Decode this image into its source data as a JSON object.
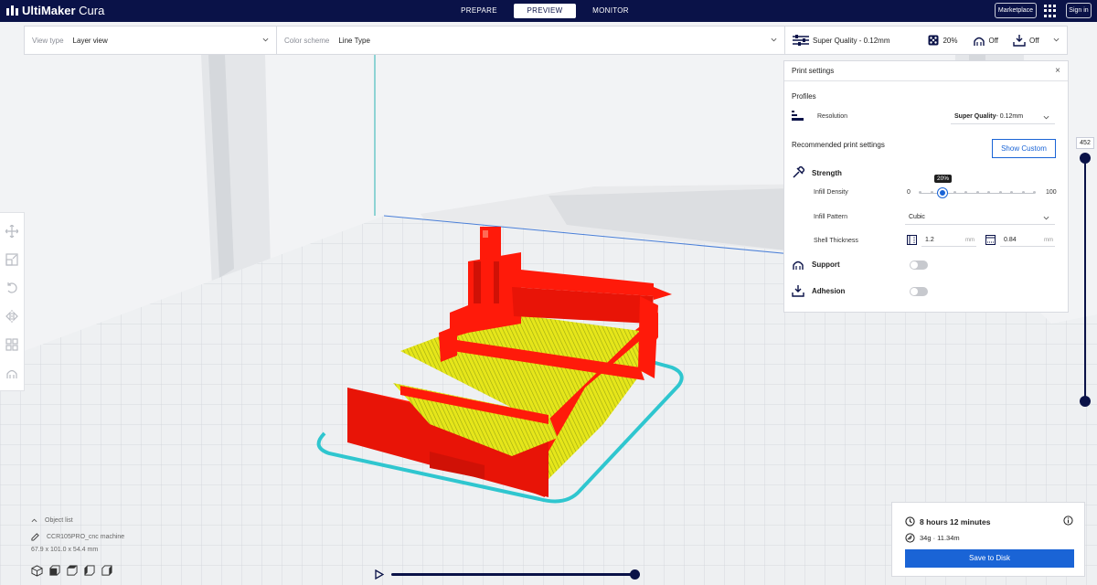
{
  "app": {
    "brand": "UltiMaker",
    "product": "Cura",
    "tabs": [
      {
        "label": "PREPARE",
        "active": false
      },
      {
        "label": "PREVIEW",
        "active": true
      },
      {
        "label": "MONITOR",
        "active": false
      }
    ],
    "marketplace_label": "Marketplace",
    "signin_label": "Sign in",
    "header_bg": "#0a1248"
  },
  "toolbar": {
    "view_type_label": "View type",
    "view_type_value": "Layer view",
    "color_scheme_label": "Color scheme",
    "color_scheme_value": "Line Type",
    "profile": "Super Quality - 0.12mm",
    "infill": "20%",
    "support": "Off",
    "adhesion": "Off"
  },
  "print_settings": {
    "title": "Print settings",
    "profiles_label": "Profiles",
    "resolution_label": "Resolution",
    "resolution_value_bold": "Super Quality",
    "resolution_value_rest": " - 0.12mm",
    "recommended_label": "Recommended print settings",
    "show_custom_label": "Show Custom",
    "strength_label": "Strength",
    "infill_density_label": "Infill Density",
    "infill_min": "0",
    "infill_max": "100",
    "infill_value_label": "20%",
    "infill_value": 20,
    "infill_pattern_label": "Infill Pattern",
    "infill_pattern_value": "Cubic",
    "shell_thickness_label": "Shell Thickness",
    "wall_value": "1.2",
    "top_bottom_value": "0.84",
    "unit": "mm",
    "support_label": "Support",
    "support_enabled": false,
    "adhesion_label": "Adhesion",
    "adhesion_enabled": false
  },
  "layer_slider": {
    "value": "452"
  },
  "object": {
    "list_label": "Object list",
    "name": "CCR105PRO_cnc machine",
    "dimensions": "67.9 x 101.0 x 54.4 mm"
  },
  "estimate": {
    "time": "8 hours 12 minutes",
    "material": "34g · 11.34m",
    "save_label": "Save to Disk"
  },
  "colors": {
    "accent": "#1a64d6",
    "model_red": "#ff1a0a",
    "infill_yellow": "#e8e81a",
    "skirt_cyan": "#2fc6cf"
  }
}
